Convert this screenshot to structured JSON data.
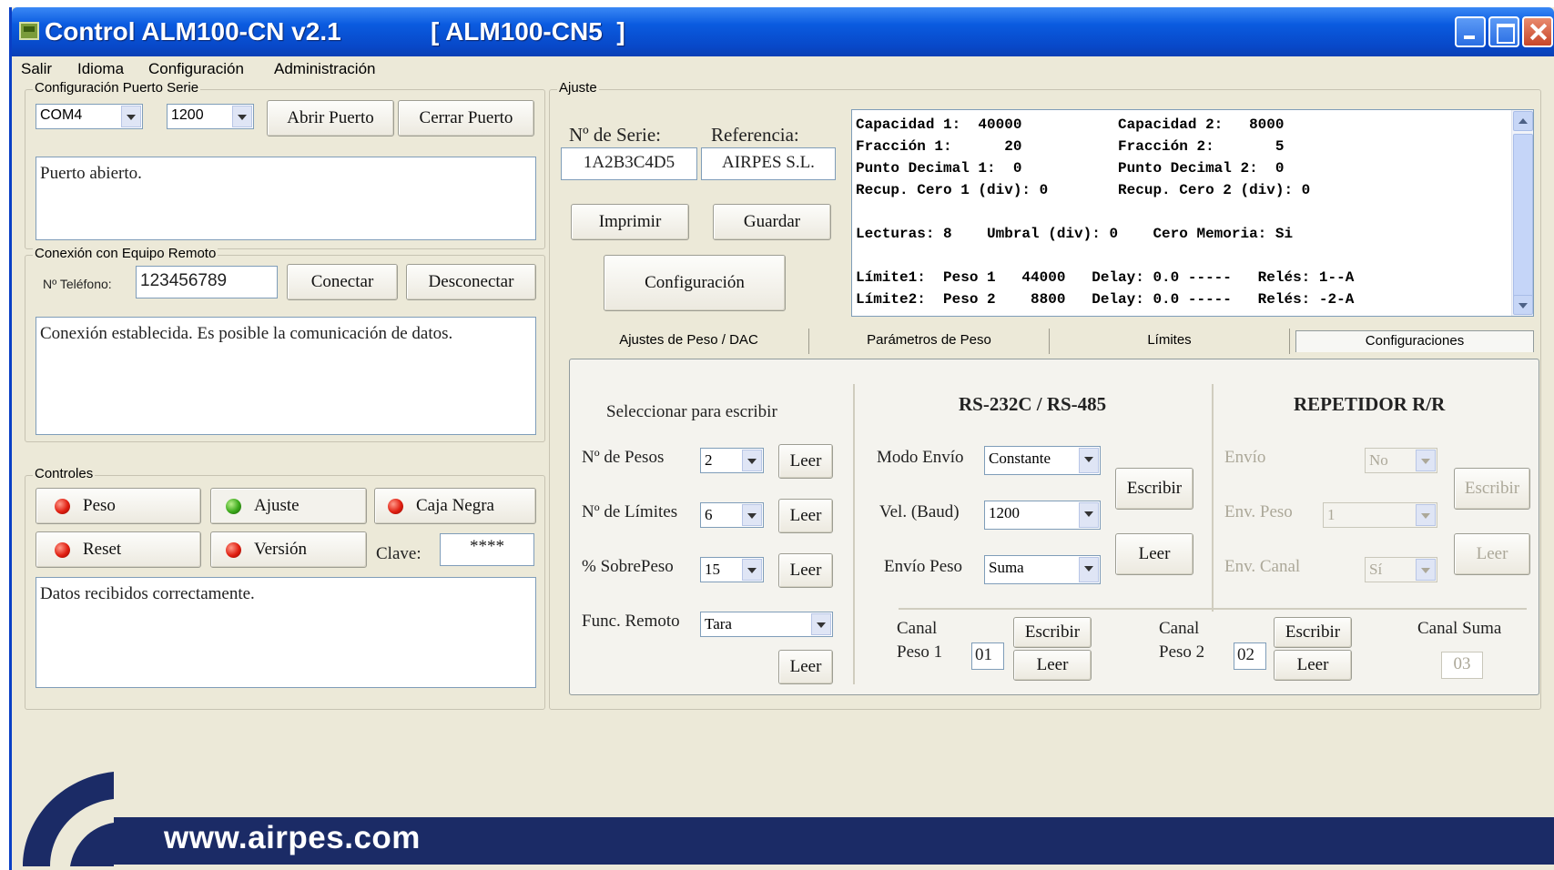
{
  "window": {
    "title": "Control ALM100-CN v2.1",
    "device": "[ ALM100-CN5  ]"
  },
  "menu": [
    "Salir",
    "Idioma",
    "Configuración",
    "Administración"
  ],
  "serial": {
    "group_label": "Configuración Puerto Serie",
    "port": "COM4",
    "baud": "1200",
    "open_label": "Abrir Puerto",
    "close_label": "Cerrar Puerto",
    "status": "Puerto abierto."
  },
  "remote": {
    "group_label": "Conexión con Equipo Remoto",
    "phone_label": "Nº Teléfono:",
    "phone": "123456789",
    "connect_label": "Conectar",
    "disconnect_label": "Desconectar",
    "status": "Conexión establecida. Es posible la comunicación de datos."
  },
  "controls": {
    "group_label": "Controles",
    "peso": "Peso",
    "ajuste": "Ajuste",
    "caja_negra": "Caja Negra",
    "reset": "Reset",
    "version": "Versión",
    "clave_label": "Clave:",
    "clave": "****",
    "status": "Datos recibidos correctamente."
  },
  "ajuste": {
    "group_label": "Ajuste",
    "serie_label": "Nº de Serie:",
    "serie": "1A2B3C4D5",
    "ref_label": "Referencia:",
    "ref": "AIRPES S.L.",
    "imprimir": "Imprimir",
    "guardar": "Guardar",
    "configuracion": "Configuración"
  },
  "info_text": "Capacidad 1:  40000           Capacidad 2:   8000\nFracción 1:      20           Fracción 2:       5\nPunto Decimal 1:  0           Punto Decimal 2:  0\nRecup. Cero 1 (div): 0        Recup. Cero 2 (div): 0\n\nLecturas: 8    Umbral (div): 0    Cero Memoria: Si\n\nLímite1:  Peso 1   44000   Delay: 0.0 -----   Relés: 1--A\nLímite2:  Peso 2    8800   Delay: 0.0 -----   Relés: -2-A",
  "tabs": [
    "Ajustes de Peso / DAC",
    "Parámetros de Peso",
    "Límites",
    "Configuraciones"
  ],
  "config": {
    "select_title": "Seleccionar para escribir",
    "n_pesos_label": "Nº de Pesos",
    "n_pesos": "2",
    "n_limites_label": "Nº de Límites",
    "n_limites": "6",
    "sobrepeso_label": "% SobrePeso",
    "sobrepeso": "15",
    "func_remoto_label": "Func. Remoto",
    "func_remoto": "Tara",
    "leer": "Leer",
    "escribir": "Escribir",
    "rs_title": "RS-232C / RS-485",
    "modo_envio_label": "Modo Envío",
    "modo_envio": "Constante",
    "vel_label": "Vel. (Baud)",
    "vel": "1200",
    "envio_peso_label": "Envío Peso",
    "envio_peso": "Suma",
    "rep_title": "REPETIDOR R/R",
    "envio_label": "Envío",
    "envio": "No",
    "env_peso_label": "Env. Peso",
    "env_peso": "1",
    "env_canal_label": "Env. Canal",
    "env_canal": "Sí",
    "canal_label": "Canal",
    "peso1_label": "Peso 1",
    "peso2_label": "Peso 2",
    "canal_suma_label": "Canal Suma",
    "canal1": "01",
    "canal2": "02",
    "canal_suma": "03"
  },
  "footer": {
    "url": "www.airpes.com"
  },
  "colors": {
    "titlebar": "#0A5BE0",
    "window_bg": "#ECE9D8",
    "footer_band": "#1B2B66"
  }
}
